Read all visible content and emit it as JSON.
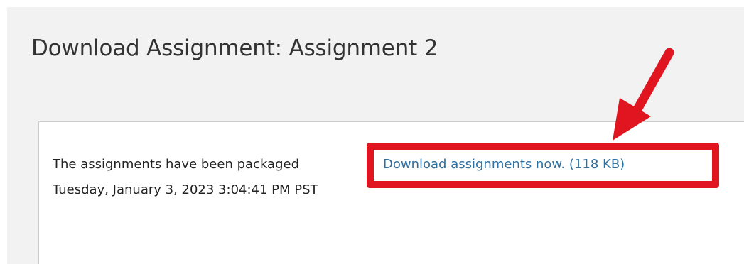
{
  "page_title": "Download Assignment: Assignment 2",
  "message": {
    "text": "The assignments have been packaged",
    "timestamp": "Tuesday, January 3, 2023 3:04:41 PM PST"
  },
  "download": {
    "link_text": "Download assignments now. (118 KB)"
  },
  "annotation": {
    "highlight_color": "#e0151f",
    "arrow_color": "#e0151f",
    "link_color": "#2f6f9f"
  }
}
